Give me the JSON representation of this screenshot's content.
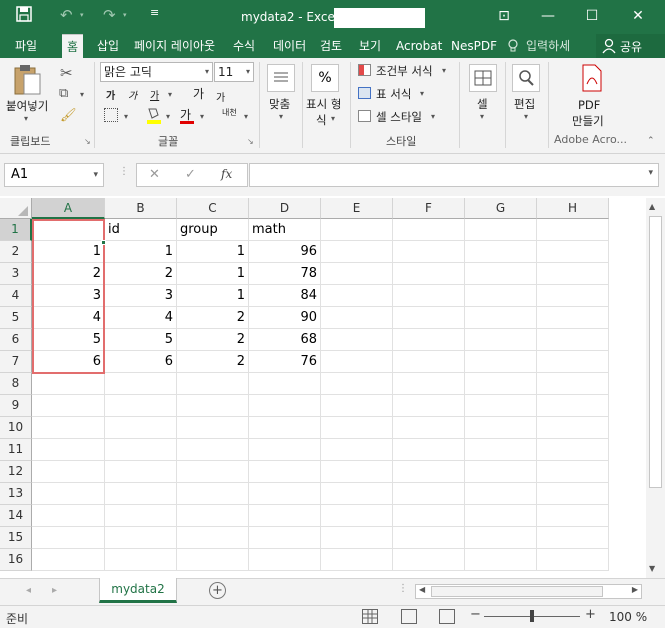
{
  "window": {
    "title": "mydata2 - Excel",
    "quick_access": {
      "save_icon": "save-icon",
      "undo": "↶",
      "redo": "↷"
    },
    "controls": {
      "ribbon_display": "⊡",
      "minimize": "—",
      "restore": "☐",
      "close": "✕"
    }
  },
  "tabs": [
    {
      "label": "파일"
    },
    {
      "label": "홈"
    },
    {
      "label": "삽입"
    },
    {
      "label": "페이지 레이아웃"
    },
    {
      "label": "수식"
    },
    {
      "label": "데이터"
    },
    {
      "label": "검토"
    },
    {
      "label": "보기"
    },
    {
      "label": "Acrobat"
    },
    {
      "label": "NesPDF"
    },
    {
      "label": "입력하세"
    }
  ],
  "share_label": "공유",
  "ribbon": {
    "clipboard": {
      "paste": "붙여넣기",
      "group": "클립보드"
    },
    "font": {
      "name": "맑은 고딕",
      "size": "11",
      "bold": "가",
      "italic": "가",
      "underline": "가",
      "grow": "가",
      "shrink": "가",
      "font_color": "가",
      "phonetic": "내천",
      "group": "글꼴"
    },
    "alignment": {
      "label": "맞춤"
    },
    "number": {
      "label1": "표시 형",
      "label2": "식",
      "percent": "%"
    },
    "styles": {
      "conditional": "조건부 서식",
      "table": "표 서식",
      "cell_style": "셀 스타일",
      "group": "스타일"
    },
    "cells": {
      "label": "셀"
    },
    "editing": {
      "label": "편집"
    },
    "pdf": {
      "label1": "PDF",
      "label2": "만들기",
      "group": "Adobe Acro..."
    }
  },
  "formula_bar": {
    "name_box": "A1",
    "cancel": "✕",
    "enter": "✓",
    "fx": "fx",
    "value": ""
  },
  "columns": [
    "A",
    "B",
    "C",
    "D",
    "E",
    "F",
    "G",
    "H"
  ],
  "rows": [
    {
      "n": "1",
      "cells": [
        "",
        "id",
        "group",
        "math",
        "",
        "",
        "",
        ""
      ]
    },
    {
      "n": "2",
      "cells": [
        "1",
        "1",
        "1",
        "96",
        "",
        "",
        "",
        ""
      ]
    },
    {
      "n": "3",
      "cells": [
        "2",
        "2",
        "1",
        "78",
        "",
        "",
        "",
        ""
      ]
    },
    {
      "n": "4",
      "cells": [
        "3",
        "3",
        "1",
        "84",
        "",
        "",
        "",
        ""
      ]
    },
    {
      "n": "5",
      "cells": [
        "4",
        "4",
        "2",
        "90",
        "",
        "",
        "",
        ""
      ]
    },
    {
      "n": "6",
      "cells": [
        "5",
        "5",
        "2",
        "68",
        "",
        "",
        "",
        ""
      ]
    },
    {
      "n": "7",
      "cells": [
        "6",
        "6",
        "2",
        "76",
        "",
        "",
        "",
        ""
      ]
    },
    {
      "n": "8",
      "cells": [
        "",
        "",
        "",
        "",
        "",
        "",
        "",
        ""
      ]
    },
    {
      "n": "9",
      "cells": [
        "",
        "",
        "",
        "",
        "",
        "",
        "",
        ""
      ]
    },
    {
      "n": "10",
      "cells": [
        "",
        "",
        "",
        "",
        "",
        "",
        "",
        ""
      ]
    },
    {
      "n": "11",
      "cells": [
        "",
        "",
        "",
        "",
        "",
        "",
        "",
        ""
      ]
    },
    {
      "n": "12",
      "cells": [
        "",
        "",
        "",
        "",
        "",
        "",
        "",
        ""
      ]
    },
    {
      "n": "13",
      "cells": [
        "",
        "",
        "",
        "",
        "",
        "",
        "",
        ""
      ]
    },
    {
      "n": "14",
      "cells": [
        "",
        "",
        "",
        "",
        "",
        "",
        "",
        ""
      ]
    },
    {
      "n": "15",
      "cells": [
        "",
        "",
        "",
        "",
        "",
        "",
        "",
        ""
      ]
    },
    {
      "n": "16",
      "cells": [
        "",
        "",
        "",
        "",
        "",
        "",
        "",
        ""
      ]
    }
  ],
  "sheet_tabs": [
    "mydata2"
  ],
  "status": {
    "ready": "준비",
    "zoom": "100 %",
    "zoom_level_percent": 100,
    "minus": "−",
    "plus": "+"
  }
}
